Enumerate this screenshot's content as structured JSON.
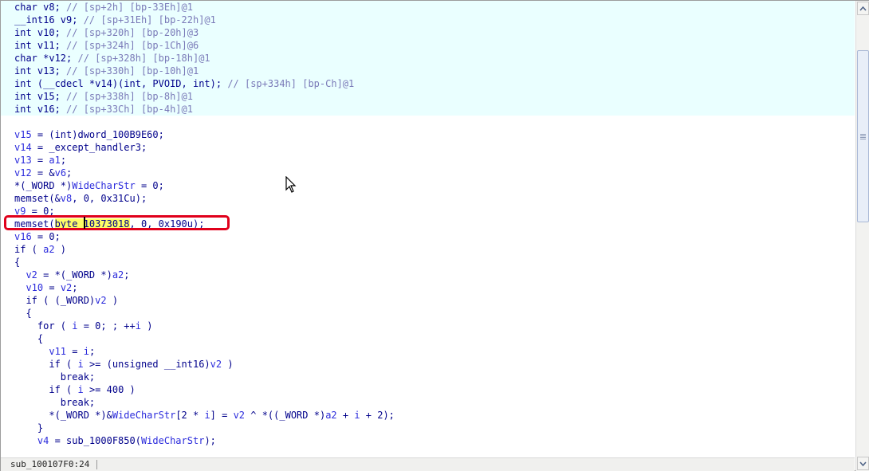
{
  "editor": {
    "lines": [
      {
        "segments": [
          {
            "t": "char v8; ",
            "c": "tok-kw"
          },
          {
            "t": "// [sp+2h] [bp-33Eh]@1",
            "c": "tok-cm"
          }
        ]
      },
      {
        "segments": [
          {
            "t": "__int16 v9; ",
            "c": "tok-kw"
          },
          {
            "t": "// [sp+31Eh] [bp-22h]@1",
            "c": "tok-cm"
          }
        ]
      },
      {
        "segments": [
          {
            "t": "int v10; ",
            "c": "tok-kw"
          },
          {
            "t": "// [sp+320h] [bp-20h]@3",
            "c": "tok-cm"
          }
        ]
      },
      {
        "segments": [
          {
            "t": "int v11; ",
            "c": "tok-kw"
          },
          {
            "t": "// [sp+324h] [bp-1Ch]@6",
            "c": "tok-cm"
          }
        ]
      },
      {
        "segments": [
          {
            "t": "char *v12; ",
            "c": "tok-kw"
          },
          {
            "t": "// [sp+328h] [bp-18h]@1",
            "c": "tok-cm"
          }
        ]
      },
      {
        "segments": [
          {
            "t": "int v13; ",
            "c": "tok-kw"
          },
          {
            "t": "// [sp+330h] [bp-10h]@1",
            "c": "tok-cm"
          }
        ]
      },
      {
        "segments": [
          {
            "t": "int (__cdecl *v14)(int, PVOID, int); ",
            "c": "tok-kw"
          },
          {
            "t": "// [sp+334h] [bp-Ch]@1",
            "c": "tok-cm"
          }
        ]
      },
      {
        "segments": [
          {
            "t": "int v15; ",
            "c": "tok-kw"
          },
          {
            "t": "// [sp+338h] [bp-8h]@1",
            "c": "tok-cm"
          }
        ]
      },
      {
        "segments": [
          {
            "t": "int v16; ",
            "c": "tok-kw"
          },
          {
            "t": "// [sp+33Ch] [bp-4h]@1",
            "c": "tok-cm"
          }
        ]
      },
      {
        "segments": []
      },
      {
        "segments": [
          {
            "t": "v15",
            "c": "tok-var"
          },
          {
            "t": " = (int)dword_100B9E60;",
            "c": "tok-kw"
          }
        ]
      },
      {
        "segments": [
          {
            "t": "v14",
            "c": "tok-var"
          },
          {
            "t": " = _except_handler3;",
            "c": "tok-kw"
          }
        ]
      },
      {
        "segments": [
          {
            "t": "v13",
            "c": "tok-var"
          },
          {
            "t": " = ",
            "c": "tok-kw"
          },
          {
            "t": "a1",
            "c": "tok-var"
          },
          {
            "t": ";",
            "c": "tok-kw"
          }
        ]
      },
      {
        "segments": [
          {
            "t": "v12",
            "c": "tok-var"
          },
          {
            "t": " = &",
            "c": "tok-kw"
          },
          {
            "t": "v6",
            "c": "tok-var"
          },
          {
            "t": ";",
            "c": "tok-kw"
          }
        ]
      },
      {
        "segments": [
          {
            "t": "*(_WORD *)",
            "c": "tok-kw"
          },
          {
            "t": "WideCharStr",
            "c": "tok-var"
          },
          {
            "t": " = 0;",
            "c": "tok-kw"
          }
        ]
      },
      {
        "segments": [
          {
            "t": "memset(&",
            "c": "tok-kw"
          },
          {
            "t": "v8",
            "c": "tok-var"
          },
          {
            "t": ", 0, 0x31Cu);",
            "c": "tok-kw"
          }
        ]
      },
      {
        "segments": [
          {
            "t": "v9",
            "c": "tok-var"
          },
          {
            "t": " = 0;",
            "c": "tok-kw"
          }
        ]
      },
      {
        "segments": [
          {
            "t": "memset(",
            "c": "tok-kw"
          },
          {
            "t": "byte",
            "c": "tok-kw hl-yellow"
          },
          {
            "t": "_10373018",
            "c": "tok-kw hl-yellow"
          },
          {
            "t": ", 0, 0x190u);",
            "c": "tok-kw"
          }
        ]
      },
      {
        "segments": [
          {
            "t": "v16",
            "c": "tok-var"
          },
          {
            "t": " = 0;",
            "c": "tok-kw"
          }
        ]
      },
      {
        "segments": [
          {
            "t": "if ( ",
            "c": "tok-kw"
          },
          {
            "t": "a2",
            "c": "tok-var"
          },
          {
            "t": " )",
            "c": "tok-kw"
          }
        ]
      },
      {
        "segments": [
          {
            "t": "{",
            "c": "tok-kw"
          }
        ]
      },
      {
        "segments": [
          {
            "t": "  ",
            "c": "tok-kw"
          },
          {
            "t": "v2",
            "c": "tok-var"
          },
          {
            "t": " = *(_WORD *)",
            "c": "tok-kw"
          },
          {
            "t": "a2",
            "c": "tok-var"
          },
          {
            "t": ";",
            "c": "tok-kw"
          }
        ]
      },
      {
        "segments": [
          {
            "t": "  ",
            "c": "tok-kw"
          },
          {
            "t": "v10",
            "c": "tok-var"
          },
          {
            "t": " = ",
            "c": "tok-kw"
          },
          {
            "t": "v2",
            "c": "tok-var"
          },
          {
            "t": ";",
            "c": "tok-kw"
          }
        ]
      },
      {
        "segments": [
          {
            "t": "  if ( (_WORD)",
            "c": "tok-kw"
          },
          {
            "t": "v2",
            "c": "tok-var"
          },
          {
            "t": " )",
            "c": "tok-kw"
          }
        ]
      },
      {
        "segments": [
          {
            "t": "  {",
            "c": "tok-kw"
          }
        ]
      },
      {
        "segments": [
          {
            "t": "    for ( ",
            "c": "tok-kw"
          },
          {
            "t": "i",
            "c": "tok-var"
          },
          {
            "t": " = 0; ; ++",
            "c": "tok-kw"
          },
          {
            "t": "i",
            "c": "tok-var"
          },
          {
            "t": " )",
            "c": "tok-kw"
          }
        ]
      },
      {
        "segments": [
          {
            "t": "    {",
            "c": "tok-kw"
          }
        ]
      },
      {
        "segments": [
          {
            "t": "      ",
            "c": "tok-kw"
          },
          {
            "t": "v11",
            "c": "tok-var"
          },
          {
            "t": " = ",
            "c": "tok-kw"
          },
          {
            "t": "i",
            "c": "tok-var"
          },
          {
            "t": ";",
            "c": "tok-kw"
          }
        ]
      },
      {
        "segments": [
          {
            "t": "      if ( ",
            "c": "tok-kw"
          },
          {
            "t": "i",
            "c": "tok-var"
          },
          {
            "t": " >= (unsigned __int16)",
            "c": "tok-kw"
          },
          {
            "t": "v2",
            "c": "tok-var"
          },
          {
            "t": " )",
            "c": "tok-kw"
          }
        ]
      },
      {
        "segments": [
          {
            "t": "        break;",
            "c": "tok-kw"
          }
        ]
      },
      {
        "segments": [
          {
            "t": "      if ( ",
            "c": "tok-kw"
          },
          {
            "t": "i",
            "c": "tok-var"
          },
          {
            "t": " >= 400 )",
            "c": "tok-kw"
          }
        ]
      },
      {
        "segments": [
          {
            "t": "        break;",
            "c": "tok-kw"
          }
        ]
      },
      {
        "segments": [
          {
            "t": "      *(_WORD *)&",
            "c": "tok-kw"
          },
          {
            "t": "WideCharStr",
            "c": "tok-var"
          },
          {
            "t": "[2 * ",
            "c": "tok-kw"
          },
          {
            "t": "i",
            "c": "tok-var"
          },
          {
            "t": "] = ",
            "c": "tok-kw"
          },
          {
            "t": "v2",
            "c": "tok-var"
          },
          {
            "t": " ^ *((_WORD *)",
            "c": "tok-kw"
          },
          {
            "t": "a2",
            "c": "tok-var"
          },
          {
            "t": " + ",
            "c": "tok-kw"
          },
          {
            "t": "i",
            "c": "tok-var"
          },
          {
            "t": " + 2);",
            "c": "tok-kw"
          }
        ]
      },
      {
        "segments": [
          {
            "t": "    }",
            "c": "tok-kw"
          }
        ]
      },
      {
        "segments": [
          {
            "t": "    ",
            "c": "tok-kw"
          },
          {
            "t": "v4",
            "c": "tok-var"
          },
          {
            "t": " = sub_1000F850(",
            "c": "tok-kw"
          },
          {
            "t": "WideCharStr",
            "c": "tok-var"
          },
          {
            "t": ");",
            "c": "tok-kw"
          }
        ]
      }
    ]
  },
  "statusbar": {
    "location": "sub_100107F0:24"
  },
  "colors": {
    "highlight_box": "#e0001b",
    "highlight_text": "#ffff66",
    "declaration_bg": "#eaffff"
  },
  "icons": {
    "scroll_up": "triangle-up-icon",
    "scroll_down": "triangle-down-icon",
    "mouse": "arrow-cursor-icon"
  }
}
